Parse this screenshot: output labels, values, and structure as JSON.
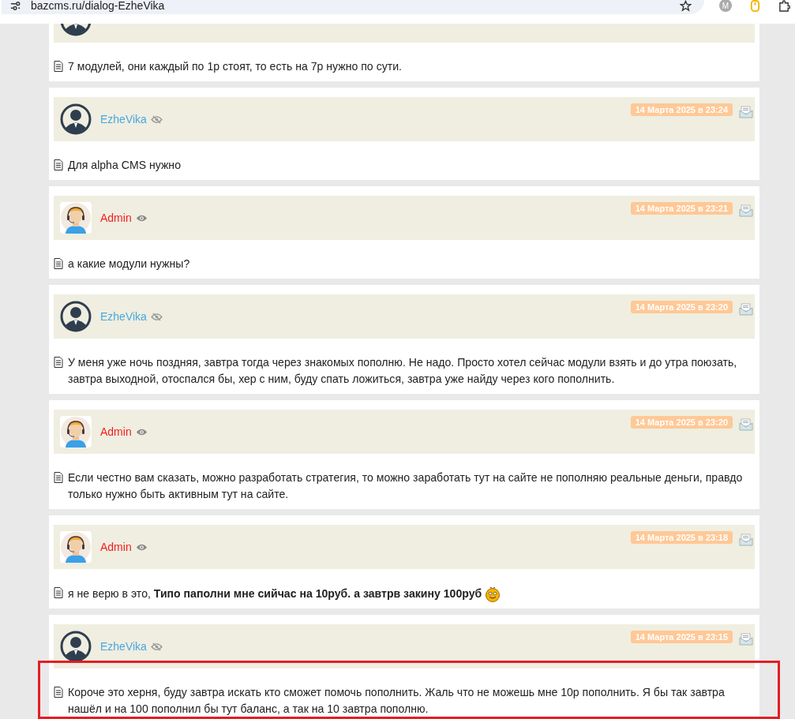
{
  "browser": {
    "url": "bazcms.ru/dialog-EzheVika",
    "account_initial": "M"
  },
  "messages": [
    {
      "kind": "user",
      "text": "7 модулей, они каждый по 1р стоят, то есть на 7р нужно по сути.",
      "highlighted": false
    },
    {
      "kind": "user",
      "name": "EzheVika",
      "online": false,
      "date": "14 Марта 2025 в 23:24",
      "text": "Для alpha CMS нужно",
      "highlighted": false
    },
    {
      "kind": "admin",
      "name": "Admin",
      "online": true,
      "date": "14 Марта 2025 в 23:21",
      "text": "а какие модули нужны?",
      "highlighted": false
    },
    {
      "kind": "user",
      "name": "EzheVika",
      "online": false,
      "date": "14 Марта 2025 в 23:20",
      "text": "У меня уже ночь поздняя, завтра тогда через знакомых пополню. Не надо. Просто хотел сейчас модули взять и до утра поюзать, завтра выходной, отоспался бы, хер с ним, буду спать ложиться, завтра уже найду через кого пополнить.",
      "highlighted": false
    },
    {
      "kind": "admin",
      "name": "Admin",
      "online": true,
      "date": "14 Марта 2025 в 23:20",
      "text": "Если честно вам сказать, можно разработать стратегия, то можно заработать тут на сайте не пополняю реальные деньги, правдо только нужно быть активным тут на сайте.",
      "highlighted": false
    },
    {
      "kind": "admin",
      "name": "Admin",
      "online": true,
      "date": "14 Марта 2025 в 23:18",
      "text": "я не верю в это, **Типо паполни мне сийчас на 10руб. а завтрв закину 100руб**",
      "smiley": true,
      "highlighted": false
    },
    {
      "kind": "user",
      "name": "EzheVika",
      "online": false,
      "date": "14 Марта 2025 в 23:15",
      "text": "Короче это херня, буду завтра искать кто сможет помочь пополнить. Жаль что не можешь мне 10р пополнить. Я бы так завтра нашёл и на 100 пополнил бы тут баланс, а так на 10 завтра пополню.",
      "highlighted": true
    }
  ]
}
